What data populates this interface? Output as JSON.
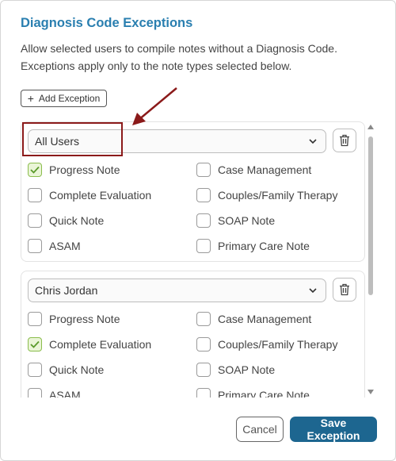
{
  "dialog": {
    "title": "Diagnosis Code Exceptions",
    "description_line1": "Allow selected users to compile notes without a Diagnosis Code.",
    "description_line2": "Exceptions apply only to the note types selected below.",
    "add_label": "Add Exception",
    "cancel_label": "Cancel",
    "save_label": "Save Exception"
  },
  "exceptions": [
    {
      "user": "All Users",
      "options": [
        {
          "label": "Progress Note",
          "checked": true
        },
        {
          "label": "Case Management",
          "checked": false
        },
        {
          "label": "Complete Evaluation",
          "checked": false
        },
        {
          "label": "Couples/Family Therapy",
          "checked": false
        },
        {
          "label": "Quick Note",
          "checked": false
        },
        {
          "label": "SOAP Note",
          "checked": false
        },
        {
          "label": "ASAM",
          "checked": false
        },
        {
          "label": "Primary Care Note",
          "checked": false
        }
      ]
    },
    {
      "user": "Chris Jordan",
      "options": [
        {
          "label": "Progress Note",
          "checked": false
        },
        {
          "label": "Case Management",
          "checked": false
        },
        {
          "label": "Complete Evaluation",
          "checked": true
        },
        {
          "label": "Couples/Family Therapy",
          "checked": false
        },
        {
          "label": "Quick Note",
          "checked": false
        },
        {
          "label": "SOAP Note",
          "checked": false
        },
        {
          "label": "ASAM",
          "checked": false
        },
        {
          "label": "Primary Care Note",
          "checked": false
        }
      ]
    }
  ],
  "icons": {
    "add": "plus-icon",
    "dropdown": "chevron-down-icon",
    "delete": "trash-icon",
    "checked": "check-icon"
  },
  "colors": {
    "title": "#2a7fb0",
    "primary_button": "#1d6690",
    "annotation": "#8b1a1a",
    "check_bg": "#eaf5d7",
    "check_mark": "#5a9a2a"
  }
}
